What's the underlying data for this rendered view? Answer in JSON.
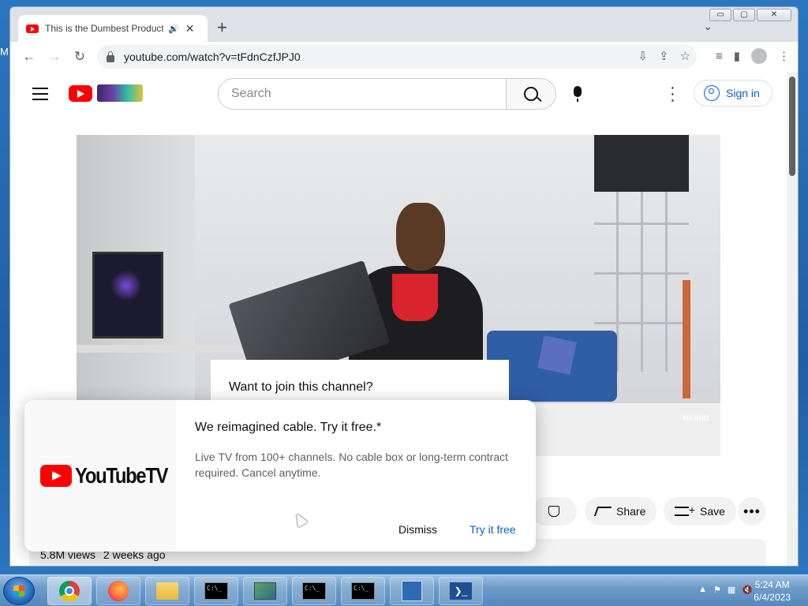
{
  "desktop": {
    "edge_letter": "M"
  },
  "browser": {
    "tab": {
      "title": "This is the Dumbest Product"
    },
    "url": "youtube.com/watch?v=tFdnCzfJPJ0",
    "window_buttons": {
      "minimize": "▭",
      "maximize": "▢",
      "close": "✕"
    }
  },
  "youtube": {
    "search_placeholder": "Search",
    "signin_label": "Sign in",
    "video_watermark": "MKBHD",
    "join_prompt": "Want to join this channel?",
    "actions": {
      "share_label": "Share",
      "save_label": "Save",
      "more_label": "•••"
    },
    "meta": {
      "views": "5.8M views",
      "age": "2 weeks ago"
    }
  },
  "ad": {
    "brand": "YouTubeTV",
    "title": "We reimagined cable. Try it free.*",
    "description": "Live TV from 100+ channels. No cable box or long-term contract required. Cancel anytime.",
    "dismiss_label": "Dismiss",
    "cta_label": "Try it free"
  },
  "taskbar": {
    "clock_time": "5:24 AM",
    "clock_date": "6/4/2023",
    "cmd_glyph": "C:\\_"
  }
}
